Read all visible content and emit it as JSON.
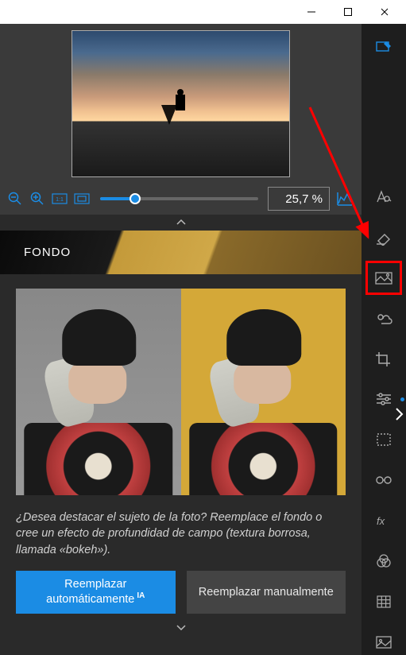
{
  "window": {
    "minimize": "—",
    "maximize": "▢",
    "close": "✕"
  },
  "zoom": {
    "value_display": "25,7 %"
  },
  "section": {
    "title": "FONDO"
  },
  "panel": {
    "description": "¿Desea destacar el sujeto de la foto? Reemplace el fondo o cree un efecto de profundidad de campo (textura borrosa, llamada «bokeh»).",
    "btn_auto": "Reemplazar automáticamente",
    "btn_auto_badge": "IA",
    "btn_manual": "Reemplazar manualmente"
  },
  "tools": {
    "edit": "edit",
    "text": "text",
    "eraser": "eraser",
    "background": "background",
    "weather": "weather",
    "crop": "crop",
    "sliders": "sliders",
    "marquee": "marquee",
    "glasses": "glasses",
    "fx": "fx",
    "venn": "venn",
    "grid": "grid",
    "image": "image"
  }
}
